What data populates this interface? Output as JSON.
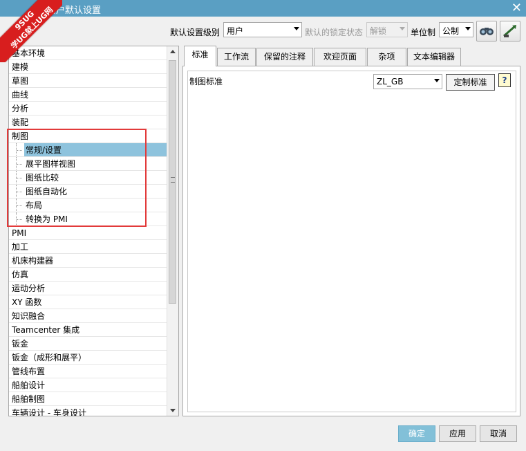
{
  "window": {
    "title": "用户默认设置",
    "close_glyph": "✕"
  },
  "watermark": {
    "line1": "9SUG",
    "line2": "学UG就上UG网"
  },
  "toolbar": {
    "level_label": "默认设置级别",
    "level_value": "用户",
    "lock_label": "默认的锁定状态",
    "lock_value": "解锁",
    "unit_label": "单位制",
    "unit_value": "公制",
    "find_icon": "binoculars-icon",
    "manage_icon": "edit-arrow-icon"
  },
  "tree": {
    "items": [
      {
        "label": "基本环境",
        "level": 0
      },
      {
        "label": "建模",
        "level": 0
      },
      {
        "label": "草图",
        "level": 0
      },
      {
        "label": "曲线",
        "level": 0
      },
      {
        "label": "分析",
        "level": 0
      },
      {
        "label": "装配",
        "level": 0
      },
      {
        "label": "制图",
        "level": 0
      },
      {
        "label": "常规/设置",
        "level": 1,
        "selected": true
      },
      {
        "label": "展平图样视图",
        "level": 1
      },
      {
        "label": "图纸比较",
        "level": 1
      },
      {
        "label": "图纸自动化",
        "level": 1
      },
      {
        "label": "布局",
        "level": 1
      },
      {
        "label": "转换为 PMI",
        "level": 1
      },
      {
        "label": "PMI",
        "level": 0
      },
      {
        "label": "加工",
        "level": 0
      },
      {
        "label": "机床构建器",
        "level": 0
      },
      {
        "label": "仿真",
        "level": 0
      },
      {
        "label": "运动分析",
        "level": 0
      },
      {
        "label": "XY 函数",
        "level": 0
      },
      {
        "label": "知识融合",
        "level": 0
      },
      {
        "label": "Teamcenter 集成",
        "level": 0
      },
      {
        "label": "钣金",
        "level": 0
      },
      {
        "label": "钣金（成形和展平）",
        "level": 0
      },
      {
        "label": "管线布置",
        "level": 0
      },
      {
        "label": "船舶设计",
        "level": 0
      },
      {
        "label": "船舶制图",
        "level": 0
      },
      {
        "label": "车辆设计 - 车身设计",
        "level": 0
      }
    ]
  },
  "tabs": [
    {
      "label": "标准",
      "active": true
    },
    {
      "label": "工作流"
    },
    {
      "label": "保留的注释"
    },
    {
      "label": "欢迎页面"
    },
    {
      "label": "杂项"
    },
    {
      "label": "文本编辑器"
    }
  ],
  "standard": {
    "label": "制图标准",
    "value": "ZL_GB",
    "customize_button": "定制标准",
    "help_glyph": "?",
    "help_icon": "help-icon"
  },
  "footer": {
    "ok": "确定",
    "apply": "应用",
    "cancel": "取消"
  },
  "colors": {
    "titlebar": "#5a9fc3",
    "selection": "#8ec3dd",
    "primary_button": "#82c0d8",
    "highlight_box": "#e23a3a"
  }
}
